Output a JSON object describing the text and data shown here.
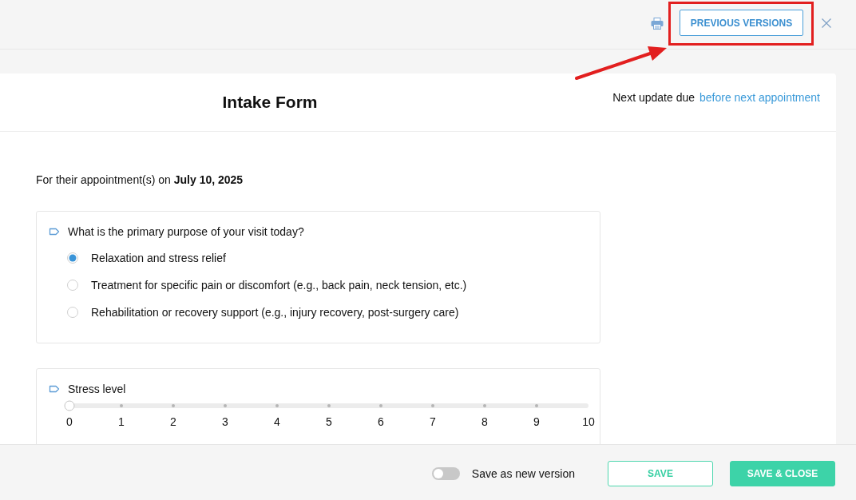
{
  "toolbar": {
    "previous_versions_button": {
      "label": "PREVIOUS VERSIONS",
      "highlighted": true
    }
  },
  "form": {
    "title": "Intake Form",
    "next_update_label": "Next update due",
    "next_update_link": "before next appointment",
    "appointment_text": "For their appointment(s) on **July 10, 2025**",
    "questions": [
      {
        "kind": "radio",
        "label": "What is the primary purpose of your visit today?",
        "options": [
          {
            "label": "Relaxation and stress relief",
            "selected": true
          },
          {
            "label": "Treatment for specific pain or discomfort (e.g., back pain, neck tension, etc.)",
            "selected": false
          },
          {
            "label": "Rehabilitation or recovery support (e.g., injury recovery, post-surgery care)",
            "selected": false
          }
        ]
      },
      {
        "kind": "scale",
        "label": "Stress level",
        "level": 0,
        "ticks": [
          "0",
          "1",
          "2",
          "3",
          "4",
          "5",
          "6",
          "7",
          "8",
          "9",
          "10"
        ]
      }
    ]
  },
  "footer": {
    "toggle": {
      "label": "Save as new version",
      "on": false
    },
    "buttons": [
      {
        "label": "SAVE",
        "kind": "outline"
      },
      {
        "label": "SAVE & CLOSE",
        "kind": "filled"
      }
    ]
  }
}
